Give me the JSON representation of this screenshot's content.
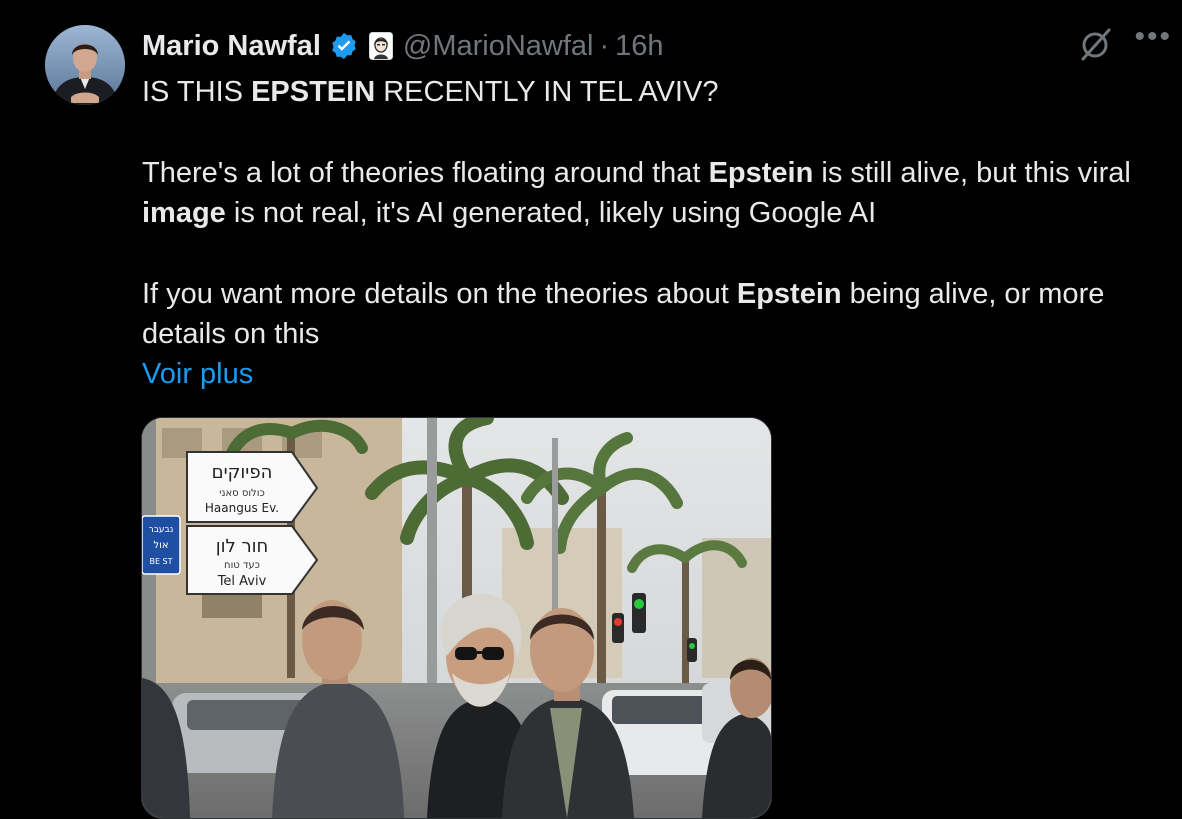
{
  "tweet": {
    "author_name": "Mario Nawfal",
    "handle": "@MarioNawfal",
    "separator": "·",
    "time": "16h",
    "title_line": {
      "pre": "IS THIS ",
      "bold": "EPSTEIN",
      "post": " RECENTLY IN TEL AVIV?"
    },
    "para1": {
      "t1": "There's a lot of theories floating around that ",
      "b1": "Epstein",
      "t2": " is still alive, but this viral ",
      "b2": "image",
      "t3": " is not real, it's AI generated, likely using Google AI"
    },
    "para2": {
      "t1": "If you want more details on the theories about ",
      "b1": "Epstein",
      "t2": " being alive, or more details on this"
    },
    "show_more": "Voir plus",
    "more_icon": "•••"
  },
  "photo": {
    "sign_top_hebrew": "הפיוקים",
    "sign_top_small": "כולוס סאני",
    "sign_top_english": "Haangus Ev.",
    "sign_bottom_hebrew": "חור לון",
    "sign_bottom_small": "כעד טוח",
    "sign_bottom_english": "Tel Aviv",
    "blue_sign_line1": "נבעבר",
    "blue_sign_line2": "אול",
    "blue_sign_line3": "BE ST"
  },
  "colors": {
    "background": "#000000",
    "text": "#e7e9ea",
    "muted": "#71767b",
    "link": "#1d9bf0",
    "verified": "#1d9bf0"
  },
  "icons": {
    "verified": "verified-badge-icon",
    "affiliate": "affiliate-badge-icon",
    "grok": "grok-icon",
    "more": "more-options-icon"
  }
}
